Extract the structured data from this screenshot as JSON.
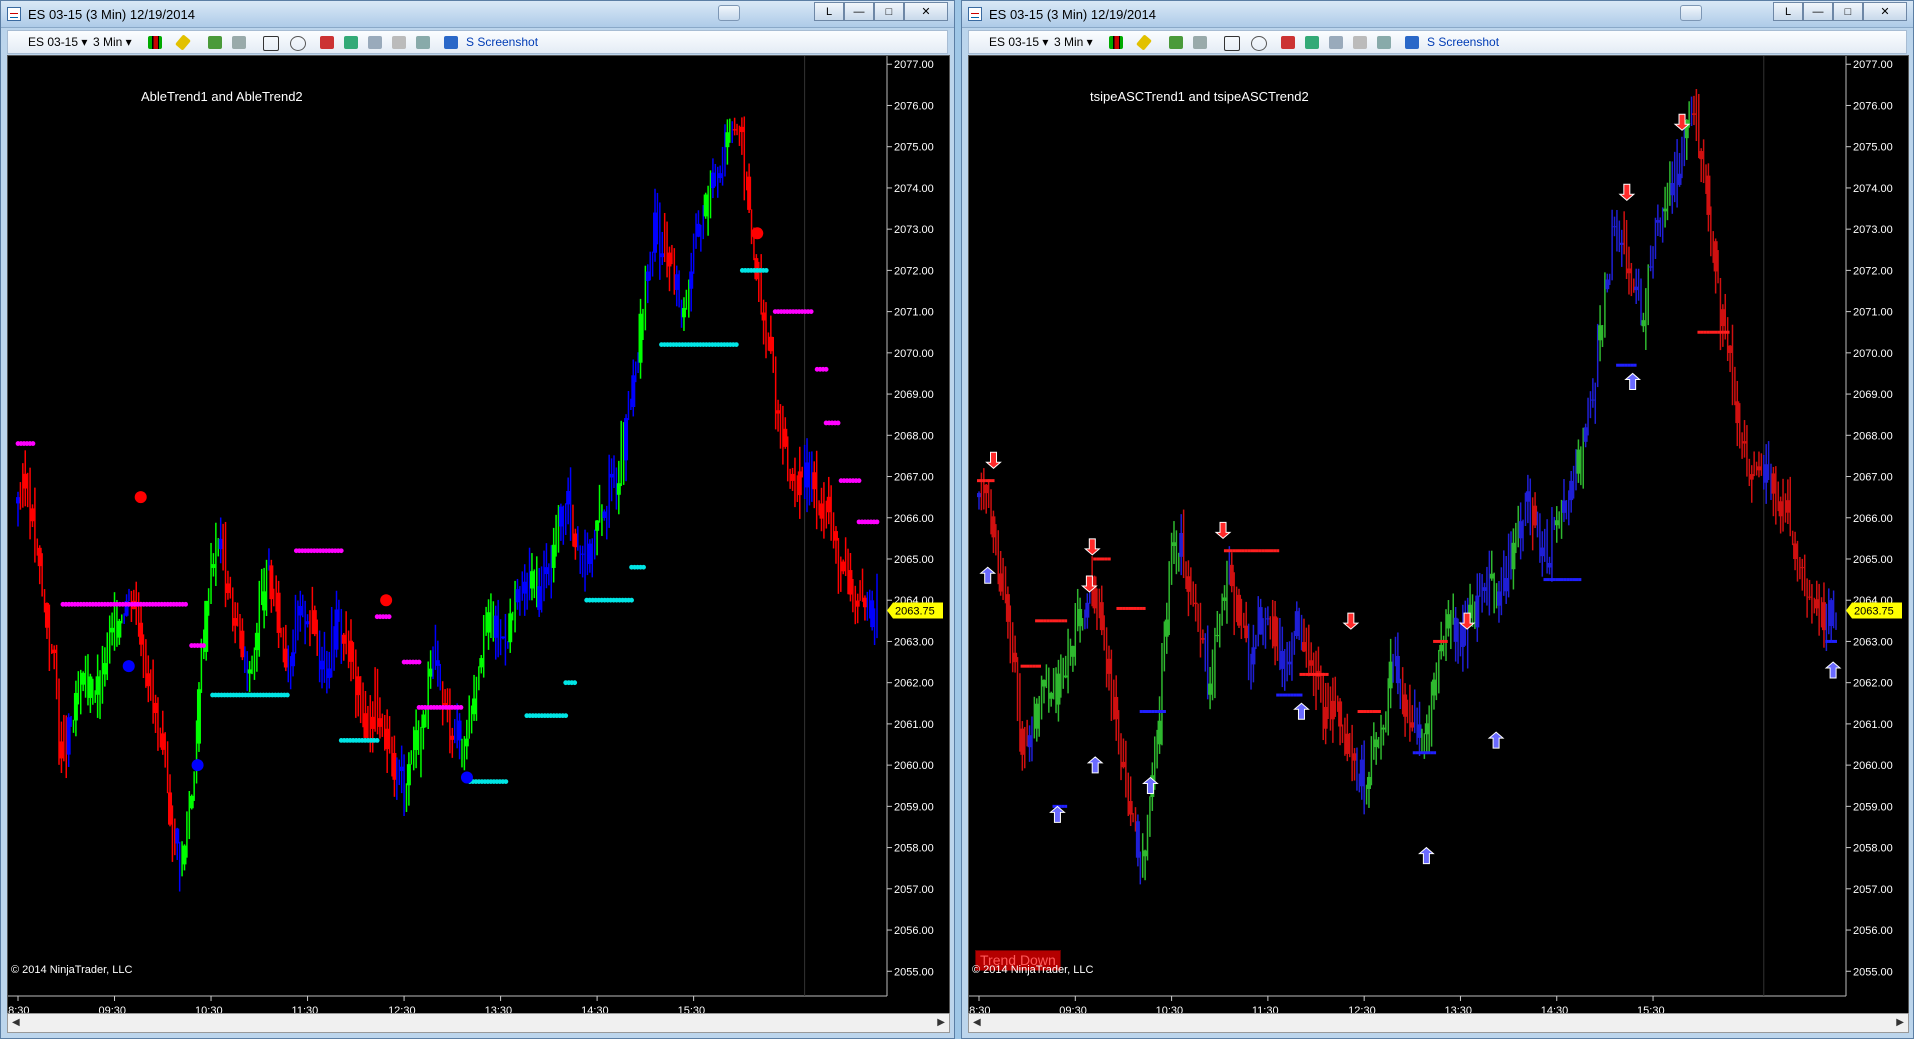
{
  "colors": {
    "bull": "#00ff00",
    "bear": "#ff0000",
    "neutral": "#0000ff",
    "cyan": "#00e5e5",
    "magenta": "#ff00ff",
    "price_tag": "#ffff00"
  },
  "windows": [
    {
      "title": "ES 03-15 (3 Min)  12/19/2014",
      "toolbar": {
        "instrument": "ES 03-15",
        "interval": "3 Min",
        "screenshot": "S Screenshot"
      },
      "overlay": "AbleTrend1 and AbleTrend2",
      "copyright": "© 2014 NinjaTrader, LLC",
      "price_label": "2063.75"
    },
    {
      "title": "ES 03-15 (3 Min)  12/19/2014",
      "toolbar": {
        "instrument": "ES 03-15",
        "interval": "3 Min",
        "screenshot": "S Screenshot"
      },
      "overlay": "tsipeASCTrend1 and tsipeASCTrend2",
      "copyright": "© 2014 NinjaTrader, LLC",
      "price_label": "2063.75",
      "badge": "Trend Down"
    }
  ],
  "window_buttons": {
    "l": "L",
    "min": "—",
    "max": "□",
    "close": "✕"
  },
  "chart_data": [
    {
      "type": "candlestick",
      "title": "AbleTrend1 and AbleTrend2",
      "y_ticks": [
        "2077.00",
        "2076.00",
        "2075.00",
        "2074.00",
        "2073.00",
        "2072.00",
        "2071.00",
        "2070.00",
        "2069.00",
        "2068.00",
        "2067.00",
        "2066.00",
        "2065.00",
        "2064.00",
        "2063.00",
        "2062.00",
        "2061.00",
        "2060.00",
        "2059.00",
        "2058.00",
        "2057.00",
        "2056.00",
        "2055.00"
      ],
      "x_ticks": [
        "08:30",
        "09:30",
        "10:30",
        "11:30",
        "12:30",
        "13:30",
        "14:30",
        "15:30"
      ],
      "ylim": [
        2054.4,
        2077.2
      ],
      "last_price": 2063.75,
      "candles_bars_colors": [
        "bear",
        "bull",
        "neutral"
      ]
    },
    {
      "type": "candlestick",
      "title": "tsipeASCTrend1 and tsipeASCTrend2",
      "y_ticks": [
        "2077.00",
        "2076.00",
        "2075.00",
        "2074.00",
        "2073.00",
        "2072.00",
        "2071.00",
        "2070.00",
        "2069.00",
        "2068.00",
        "2067.00",
        "2066.00",
        "2065.00",
        "2064.00",
        "2063.00",
        "2062.00",
        "2061.00",
        "2060.00",
        "2059.00",
        "2058.00",
        "2057.00",
        "2056.00",
        "2055.00"
      ],
      "x_ticks": [
        "08:30",
        "09:30",
        "10:30",
        "11:30",
        "12:30",
        "13:30",
        "14:30",
        "15:30"
      ],
      "ylim": [
        2054.4,
        2077.2
      ],
      "last_price": 2063.75
    }
  ],
  "price_path": [
    [
      0,
      2066.5
    ],
    [
      4,
      2066.8
    ],
    [
      8,
      2065.0
    ],
    [
      12,
      2063.5
    ],
    [
      16,
      2062.0
    ],
    [
      18,
      2060.0
    ],
    [
      22,
      2061.0
    ],
    [
      28,
      2062.0
    ],
    [
      34,
      2061.8
    ],
    [
      38,
      2063.0
    ],
    [
      44,
      2064.0
    ],
    [
      48,
      2064.2
    ],
    [
      52,
      2063.0
    ],
    [
      56,
      2061.5
    ],
    [
      60,
      2060.0
    ],
    [
      64,
      2058.5
    ],
    [
      68,
      2057.5
    ],
    [
      70,
      2058.5
    ],
    [
      74,
      2060.5
    ],
    [
      76,
      2062.5
    ],
    [
      80,
      2065.0
    ],
    [
      84,
      2065.5
    ],
    [
      88,
      2064.0
    ],
    [
      92,
      2063.0
    ],
    [
      96,
      2062.0
    ],
    [
      100,
      2063.8
    ],
    [
      104,
      2064.5
    ],
    [
      108,
      2063.5
    ],
    [
      112,
      2062.5
    ],
    [
      116,
      2063.5
    ],
    [
      120,
      2063.8
    ],
    [
      124,
      2063.0
    ],
    [
      128,
      2062.5
    ],
    [
      132,
      2063.5
    ],
    [
      136,
      2063.0
    ],
    [
      140,
      2062.0
    ],
    [
      144,
      2061.0
    ],
    [
      148,
      2061.5
    ],
    [
      152,
      2060.5
    ],
    [
      156,
      2060.0
    ],
    [
      160,
      2059.6
    ],
    [
      164,
      2060.5
    ],
    [
      168,
      2061.0
    ],
    [
      172,
      2062.5
    ],
    [
      176,
      2061.5
    ],
    [
      180,
      2061.0
    ],
    [
      184,
      2060.5
    ],
    [
      188,
      2061.5
    ],
    [
      192,
      2063.0
    ],
    [
      196,
      2063.5
    ],
    [
      200,
      2063.0
    ],
    [
      204,
      2063.5
    ],
    [
      208,
      2064.0
    ],
    [
      212,
      2064.5
    ],
    [
      216,
      2064.2
    ],
    [
      220,
      2064.8
    ],
    [
      224,
      2065.8
    ],
    [
      228,
      2066.2
    ],
    [
      232,
      2065.5
    ],
    [
      236,
      2065.0
    ],
    [
      240,
      2065.8
    ],
    [
      244,
      2066.5
    ],
    [
      248,
      2067.0
    ],
    [
      252,
      2068.0
    ],
    [
      256,
      2069.5
    ],
    [
      260,
      2071.5
    ],
    [
      264,
      2073.0
    ],
    [
      268,
      2072.5
    ],
    [
      272,
      2071.8
    ],
    [
      276,
      2071.0
    ],
    [
      280,
      2072.5
    ],
    [
      284,
      2073.5
    ],
    [
      288,
      2074.0
    ],
    [
      292,
      2075.0
    ],
    [
      296,
      2075.8
    ],
    [
      300,
      2075.0
    ],
    [
      304,
      2073.0
    ],
    [
      308,
      2071.0
    ],
    [
      312,
      2070.0
    ],
    [
      316,
      2068.0
    ],
    [
      320,
      2067.0
    ],
    [
      324,
      2066.8
    ],
    [
      328,
      2067.0
    ],
    [
      332,
      2066.5
    ],
    [
      336,
      2066.2
    ],
    [
      340,
      2065.0
    ],
    [
      344,
      2064.5
    ],
    [
      348,
      2064.0
    ],
    [
      352,
      2063.5
    ],
    [
      356,
      2063.75
    ]
  ]
}
